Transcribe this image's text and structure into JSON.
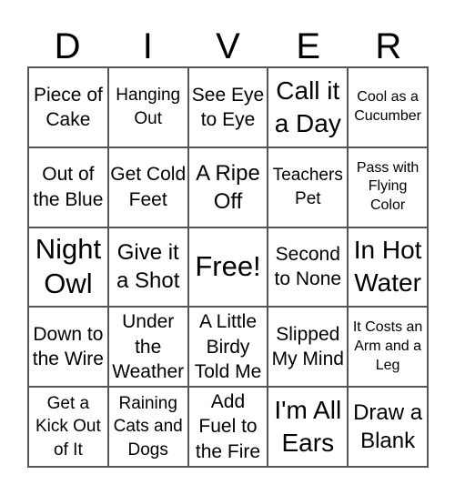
{
  "header": {
    "letters": [
      "D",
      "I",
      "V",
      "E",
      "R"
    ]
  },
  "board": {
    "rows": [
      [
        "Piece of Cake",
        "Hanging Out",
        "See Eye to Eye",
        "Call it a Day",
        "Cool as a Cucumber"
      ],
      [
        "Out of the Blue",
        "Get Cold Feet",
        "A Ripe Off",
        "Teachers Pet",
        "Pass with Flying Color"
      ],
      [
        "Night Owl",
        "Give it a Shot",
        "Free!",
        "Second to None",
        "In Hot Water"
      ],
      [
        "Down to the Wire",
        "Under the Weather",
        "A Little Birdy Told Me",
        "Slipped My Mind",
        "It Costs an Arm and a Leg"
      ],
      [
        "Get a Kick Out of It",
        "Raining Cats and Dogs",
        "Add Fuel to the Fire",
        "I'm All Ears",
        "Draw a Blank"
      ]
    ]
  }
}
